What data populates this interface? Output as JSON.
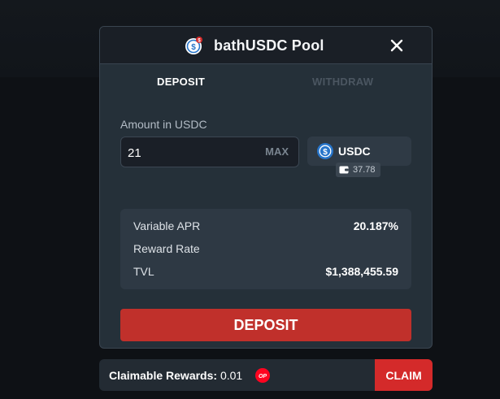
{
  "modal": {
    "title": "bathUSDC Pool",
    "pool_icon": "usdc-coin-with-badge-icon",
    "close_icon": "close-icon"
  },
  "tabs": [
    {
      "label": "DEPOSIT",
      "active": true
    },
    {
      "label": "WITHDRAW",
      "active": false
    }
  ],
  "amount": {
    "label": "Amount in USDC",
    "value": "21",
    "max_label": "MAX"
  },
  "token": {
    "symbol": "USDC",
    "icon": "usdc-icon",
    "balance": "37.78",
    "balance_icon": "wallet-icon"
  },
  "stats": [
    {
      "label": "Variable APR",
      "value": "20.187%"
    },
    {
      "label": "Reward Rate",
      "value": ""
    },
    {
      "label": "TVL",
      "value": "$1,388,455.59"
    }
  ],
  "deposit_button": "DEPOSIT",
  "rewards": {
    "label": "Claimable Rewards:",
    "value": "0.01",
    "token_icon": "op-token-icon",
    "claim_label": "CLAIM"
  },
  "colors": {
    "accent_red": "#c0302b",
    "claim_red": "#d42a2a",
    "panel": "#253039",
    "usdc_blue": "#2775ca"
  }
}
